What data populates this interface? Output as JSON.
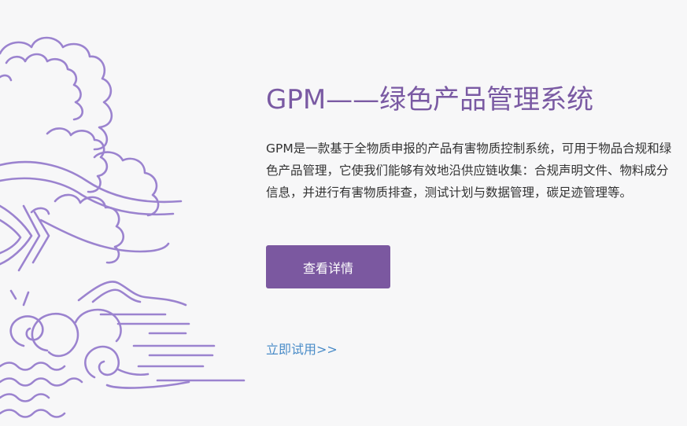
{
  "hero": {
    "title": "GPM——绿色产品管理系统",
    "description": "GPM是一款基于全物质申报的产品有害物质控制系统，可用于物品合规和绿色产品管理，它使我们能够有效地沿供应链收集：合规声明文件、物料成分信息，并进行有害物质排查，测试计划与数据管理，碳足迹管理等。",
    "detail_button": "查看详情",
    "trial_link": "立即试用>>"
  },
  "colors": {
    "accent": "#7b58a0",
    "title": "#7a5aa3",
    "link": "#4a8cc8",
    "background": "#f7f7f8",
    "illustration_stroke": "#9b83cf"
  },
  "illustration": {
    "icon": "cloud-mountain-wave-illustration"
  }
}
